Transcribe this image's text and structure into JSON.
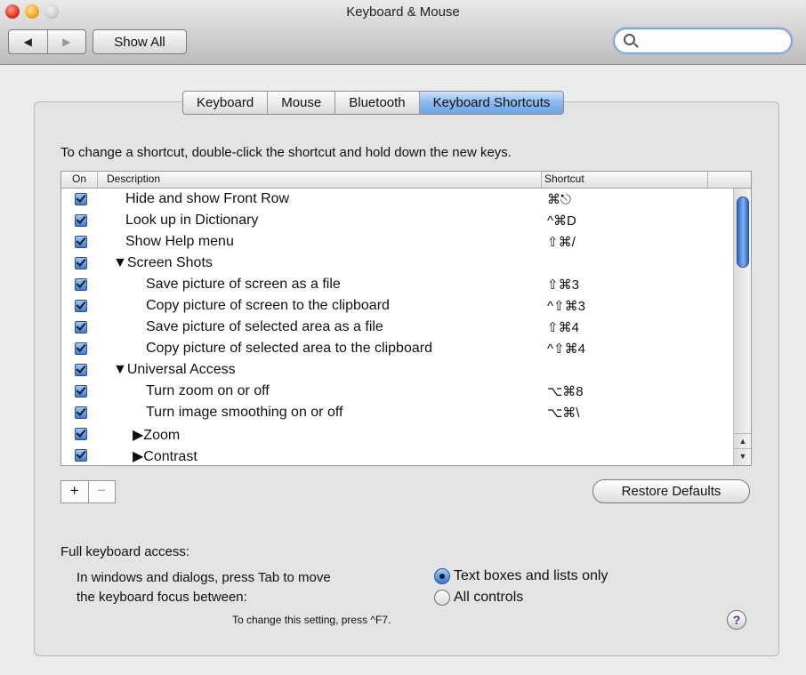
{
  "window": {
    "title": "Keyboard & Mouse"
  },
  "toolbar": {
    "back_glyph": "◀",
    "forward_glyph": "▶",
    "show_all_label": "Show All",
    "search_placeholder": ""
  },
  "tabs": [
    {
      "label": "Keyboard",
      "active": false
    },
    {
      "label": "Mouse",
      "active": false
    },
    {
      "label": "Bluetooth",
      "active": false
    },
    {
      "label": "Keyboard Shortcuts",
      "active": true
    }
  ],
  "instruction": "To change a shortcut, double-click the shortcut and hold down the new keys.",
  "table": {
    "headers": {
      "on": "On",
      "description": "Description",
      "shortcut": "Shortcut"
    },
    "rows": [
      {
        "checked": true,
        "description": "Hide and show Front Row",
        "shortcut": "⌘⎋"
      },
      {
        "checked": true,
        "description": "Look up in Dictionary",
        "shortcut": "^⌘D"
      },
      {
        "checked": true,
        "description": "Show Help menu",
        "shortcut": "⇧⌘/"
      },
      {
        "checked": true,
        "description": "▼Screen Shots",
        "shortcut": ""
      },
      {
        "checked": true,
        "description": "Save picture of screen as a file",
        "shortcut": "⇧⌘3"
      },
      {
        "checked": true,
        "description": "Copy picture of screen to the clipboard",
        "shortcut": "^⇧⌘3"
      },
      {
        "checked": true,
        "description": "Save picture of selected area as a file",
        "shortcut": "⇧⌘4"
      },
      {
        "checked": true,
        "description": "Copy picture of selected area to the clipboard",
        "shortcut": "^⇧⌘4"
      },
      {
        "checked": true,
        "description": "▼Universal Access",
        "shortcut": ""
      },
      {
        "checked": true,
        "description": "Turn zoom on or off",
        "shortcut": "⌥⌘8"
      },
      {
        "checked": true,
        "description": "Turn image smoothing on or off",
        "shortcut": "⌥⌘\\"
      },
      {
        "checked": true,
        "description": "▶Zoom",
        "shortcut": ""
      },
      {
        "checked": true,
        "description": "▶Contrast",
        "shortcut": ""
      }
    ]
  },
  "buttons": {
    "plus": "+",
    "minus": "−",
    "restore_defaults": "Restore Defaults"
  },
  "full_keyboard_access": {
    "label": "Full keyboard access:",
    "description_line1": "In windows and dialogs, press Tab to move",
    "description_line2": "the keyboard focus between:",
    "options": [
      {
        "label": "Text boxes and lists only",
        "selected": true
      },
      {
        "label": "All controls",
        "selected": false
      }
    ],
    "change_hint": "To change this setting, press ^F7."
  },
  "help": "?",
  "colors": {
    "accent": "#6ea6e6",
    "window_background": "#ececec"
  }
}
